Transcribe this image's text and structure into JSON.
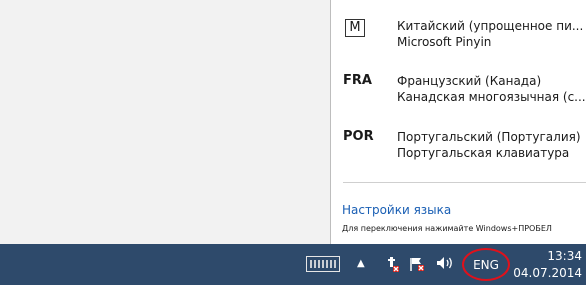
{
  "language_flyout": {
    "items": [
      {
        "code": "M",
        "name": "Китайский (упрощенное пи...",
        "layout": "Microsoft Pinyin"
      },
      {
        "code": "FRA",
        "name": "Французский (Канада)",
        "layout": "Канадская многоязычная (с..."
      },
      {
        "code": "POR",
        "name": "Португальский (Португалия)",
        "layout": "Португальская клавиатура"
      }
    ],
    "settings_link": "Настройки языка",
    "hint": "Для переключения нажимайте Windows+ПРОБЕЛ"
  },
  "taskbar": {
    "keyboard_icon": "touch-keyboard-icon",
    "show_hidden_icon": "chevron-up-icon",
    "network_icon": "network-icon",
    "action_center_icon": "action-center-flag-icon",
    "volume_icon": "speaker-icon",
    "language": "ENG",
    "time": "13:34",
    "date": "04.07.2014"
  },
  "colors": {
    "taskbar": "#2e4a6b",
    "link": "#1a5fb4",
    "highlight_circle": "#e0111b",
    "alert_red": "#d9251d"
  }
}
